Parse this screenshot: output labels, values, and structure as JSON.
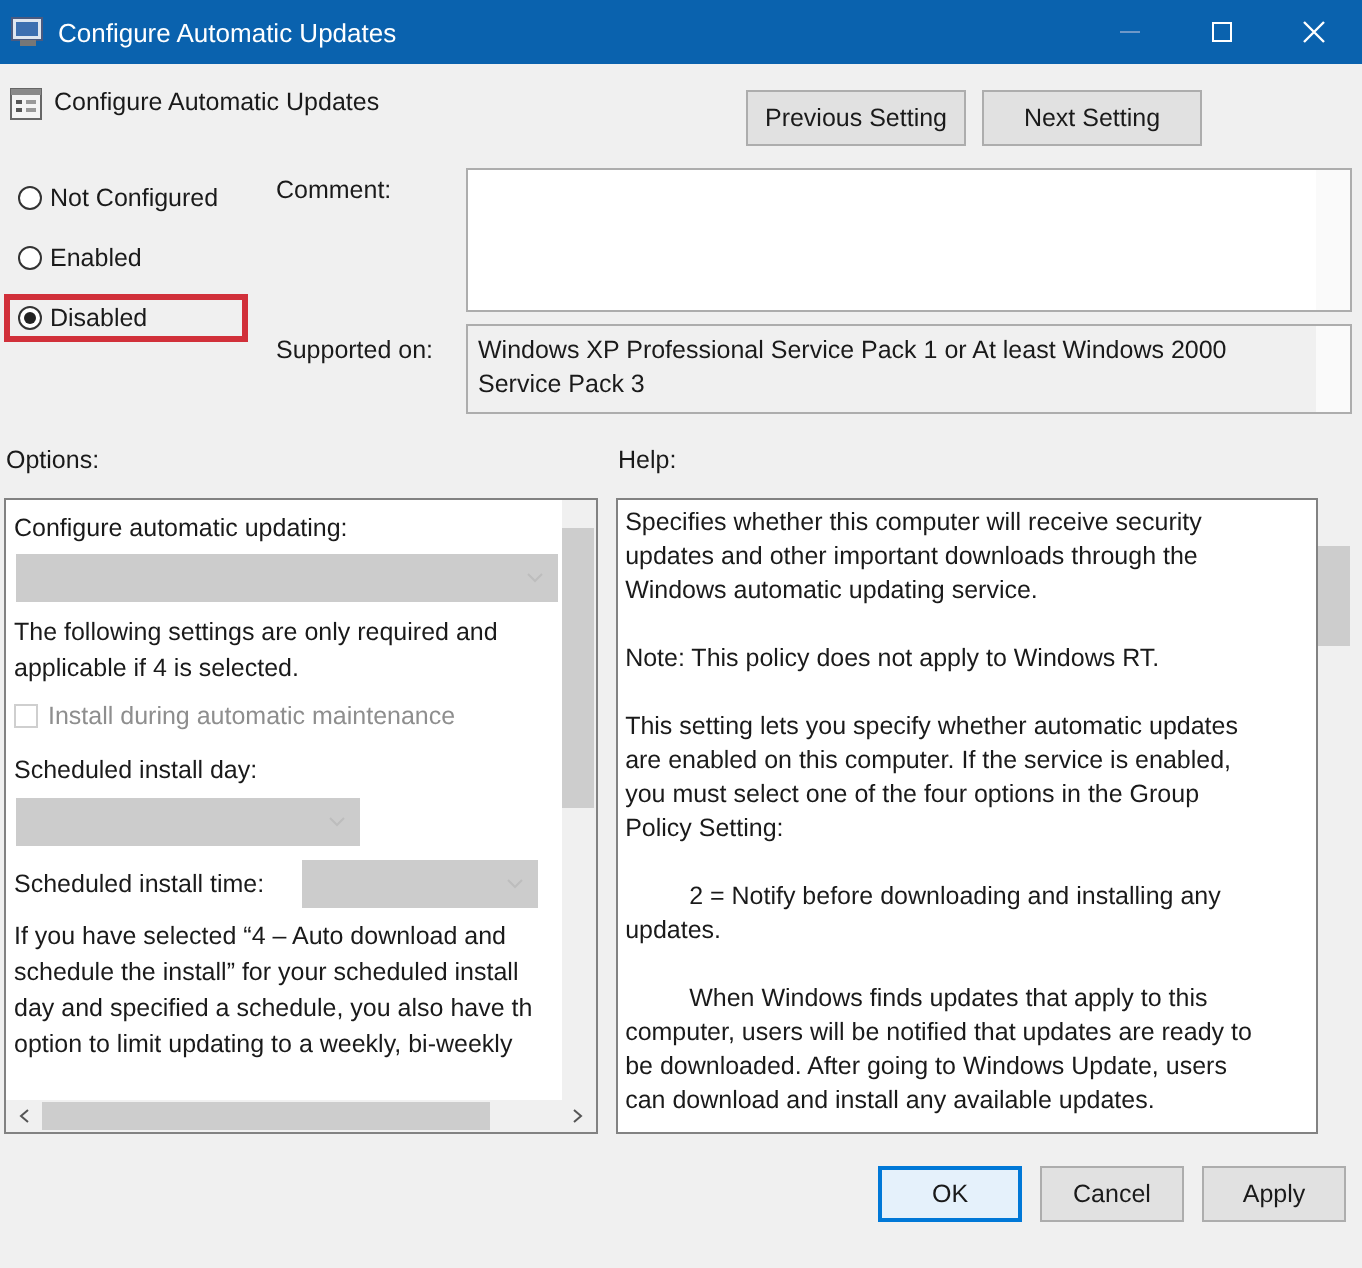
{
  "window": {
    "title": "Configure Automatic Updates"
  },
  "header": {
    "title": "Configure Automatic Updates",
    "buttons": [
      {
        "label": "Previous Setting"
      },
      {
        "label": "Next Setting"
      }
    ]
  },
  "state_options": [
    {
      "label": "Not Configured",
      "selected": false,
      "highlighted": false
    },
    {
      "label": "Enabled",
      "selected": false,
      "highlighted": false
    },
    {
      "label": "Disabled",
      "selected": true,
      "highlighted": true
    }
  ],
  "comment": {
    "label": "Comment:"
  },
  "supported_on": {
    "label": "Supported on:",
    "value": "Windows XP Professional Service Pack 1 or At least Windows 2000 Service Pack 3"
  },
  "options": {
    "label": "Options:",
    "items": [
      {
        "kind": "label",
        "text": "Configure automatic updating:"
      },
      {
        "kind": "wide-dropdown",
        "disabled": true
      },
      {
        "kind": "text",
        "lines": [
          "The following settings are only required and",
          "applicable if 4 is selected."
        ]
      },
      {
        "kind": "checkbox",
        "text": "Install during automatic maintenance",
        "checked": false,
        "disabled": true
      },
      {
        "kind": "label",
        "text": "Scheduled install day:"
      },
      {
        "kind": "dropdown",
        "disabled": true
      },
      {
        "kind": "inline-dropdown",
        "text": "Scheduled install time:",
        "disabled": true
      },
      {
        "kind": "text",
        "lines": [
          "If you have selected “4 – Auto download and",
          "schedule the install” for your scheduled install",
          "day and specified a schedule, you also have th",
          "option to limit updating to a weekly, bi-weekly"
        ]
      }
    ]
  },
  "help": {
    "label": "Help:",
    "paragraphs": [
      {
        "indent": false,
        "lines": [
          "Specifies whether this computer will receive security",
          "updates and other important downloads through the",
          "Windows automatic updating service."
        ]
      },
      {
        "indent": false,
        "lines": [
          "Note: This policy does not apply to Windows RT."
        ]
      },
      {
        "indent": false,
        "lines": [
          "This setting lets you specify whether automatic updates",
          "are enabled on this computer. If the service is enabled,",
          "you must select one of the four options in the Group",
          "Policy Setting:"
        ]
      },
      {
        "indent": true,
        "lines": [
          "2 = Notify before downloading and installing any",
          "updates."
        ]
      },
      {
        "indent": true,
        "lines": [
          "When Windows finds updates that apply to this",
          "computer, users will be notified that updates are ready to",
          "be downloaded. After going to Windows Update, users",
          "can download and install any available updates."
        ]
      }
    ]
  },
  "buttons": [
    {
      "label": "OK",
      "default": true
    },
    {
      "label": "Cancel",
      "default": false
    },
    {
      "label": "Apply",
      "default": false
    }
  ]
}
